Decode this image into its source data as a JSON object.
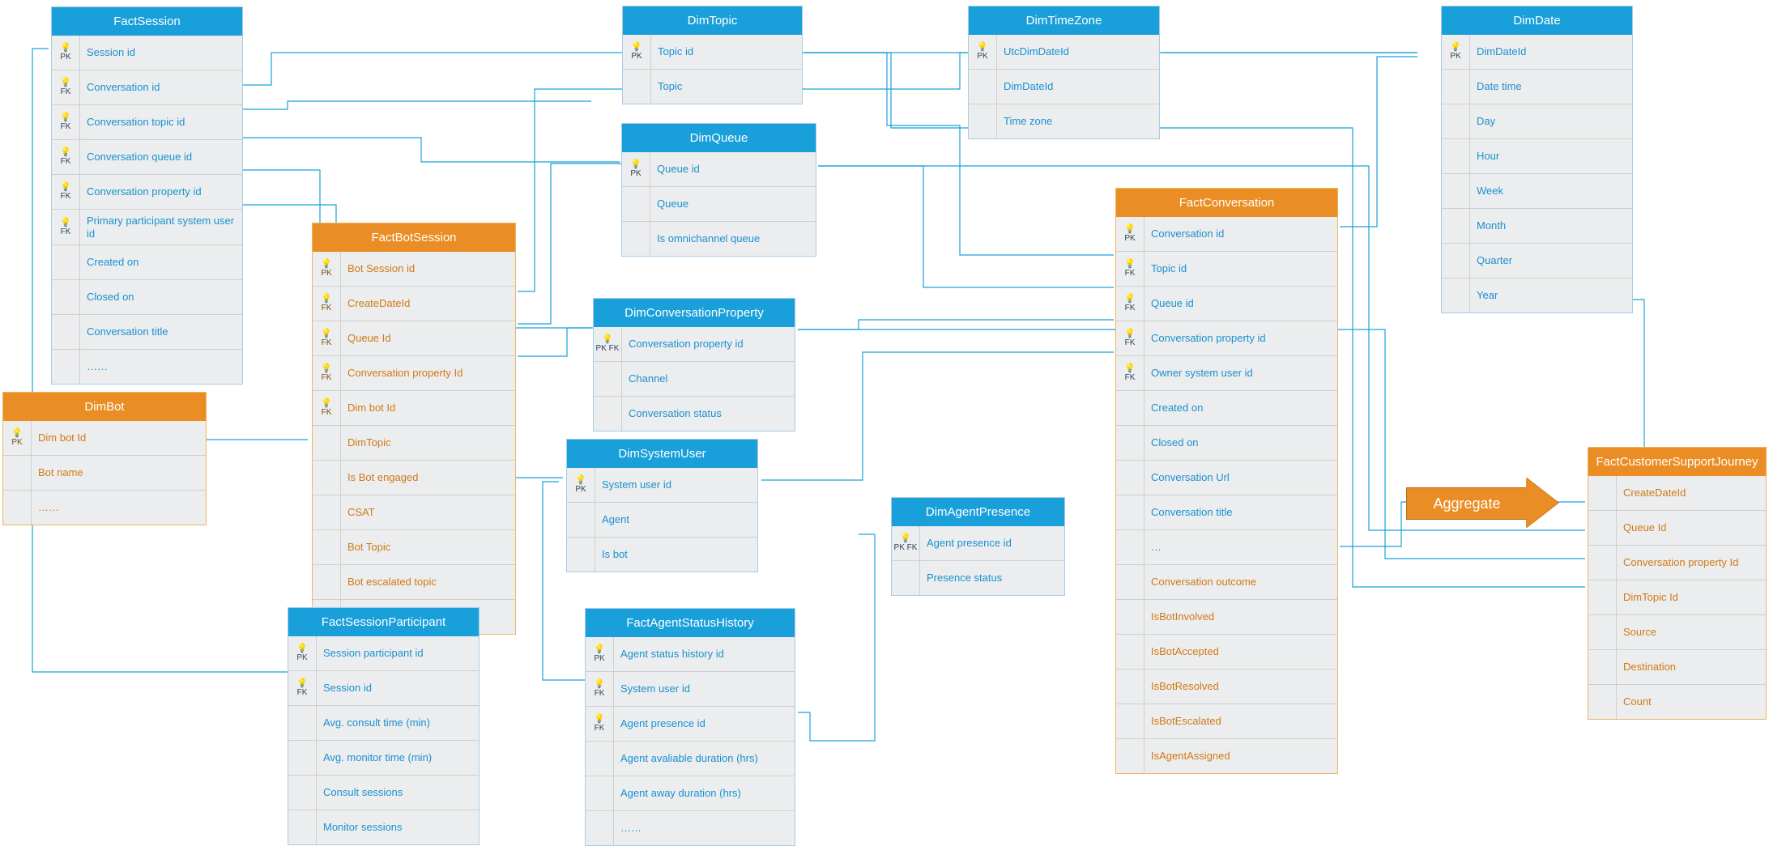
{
  "entities": {
    "factSession": {
      "title": "FactSession",
      "rows": [
        {
          "key": "PK",
          "label": "Session id"
        },
        {
          "key": "FK",
          "label": "Conversation id"
        },
        {
          "key": "FK",
          "label": "Conversation topic id"
        },
        {
          "key": "FK",
          "label": "Conversation queue id"
        },
        {
          "key": "FK",
          "label": "Conversation property id"
        },
        {
          "key": "FK",
          "label": "Primary participant system user id"
        },
        {
          "key": "",
          "label": "Created on"
        },
        {
          "key": "",
          "label": "Closed on"
        },
        {
          "key": "",
          "label": "Conversation title"
        },
        {
          "key": "",
          "label": "……"
        }
      ]
    },
    "dimBot": {
      "title": "DimBot",
      "rows": [
        {
          "key": "PK",
          "label": "Dim bot Id"
        },
        {
          "key": "",
          "label": "Bot name"
        },
        {
          "key": "",
          "label": "……"
        }
      ]
    },
    "factBotSession": {
      "title": "FactBotSession",
      "rows": [
        {
          "key": "PK",
          "label": "Bot Session id"
        },
        {
          "key": "FK",
          "label": "CreateDateId"
        },
        {
          "key": "FK",
          "label": "Queue Id"
        },
        {
          "key": "FK",
          "label": "Conversation property Id"
        },
        {
          "key": "FK",
          "label": "Dim bot Id"
        },
        {
          "key": "",
          "label": "DimTopic"
        },
        {
          "key": "",
          "label": "Is Bot engaged"
        },
        {
          "key": "",
          "label": "CSAT"
        },
        {
          "key": "",
          "label": "Bot Topic"
        },
        {
          "key": "",
          "label": "Bot escalated topic"
        },
        {
          "key": "",
          "label": "……"
        }
      ]
    },
    "factSessionParticipant": {
      "title": "FactSessionParticipant",
      "rows": [
        {
          "key": "PK",
          "label": "Session participant id"
        },
        {
          "key": "FK",
          "label": "Session id"
        },
        {
          "key": "",
          "label": "Avg. consult time (min)"
        },
        {
          "key": "",
          "label": "Avg. monitor time (min)"
        },
        {
          "key": "",
          "label": "Consult sessions"
        },
        {
          "key": "",
          "label": "Monitor sessions"
        }
      ]
    },
    "dimTopic": {
      "title": "DimTopic",
      "rows": [
        {
          "key": "PK",
          "label": "Topic id"
        },
        {
          "key": "",
          "label": "Topic"
        }
      ]
    },
    "dimQueue": {
      "title": "DimQueue",
      "rows": [
        {
          "key": "PK",
          "label": "Queue id"
        },
        {
          "key": "",
          "label": "Queue"
        },
        {
          "key": "",
          "label": "Is omnichannel queue"
        }
      ]
    },
    "dimConversationProperty": {
      "title": "DimConversationProperty",
      "rows": [
        {
          "key": "PK FK",
          "label": "Conversation property id"
        },
        {
          "key": "",
          "label": "Channel"
        },
        {
          "key": "",
          "label": "Conversation status"
        }
      ]
    },
    "dimSystemUser": {
      "title": "DimSystemUser",
      "rows": [
        {
          "key": "PK",
          "label": "System user id"
        },
        {
          "key": "",
          "label": "Agent"
        },
        {
          "key": "",
          "label": "Is bot"
        }
      ]
    },
    "factAgentStatusHistory": {
      "title": "FactAgentStatusHistory",
      "rows": [
        {
          "key": "PK",
          "label": "Agent status history id"
        },
        {
          "key": "FK",
          "label": "System user id"
        },
        {
          "key": "FK",
          "label": "Agent presence id"
        },
        {
          "key": "",
          "label": "Agent avaliable duration (hrs)"
        },
        {
          "key": "",
          "label": "Agent away duration (hrs)"
        },
        {
          "key": "",
          "label": "……"
        }
      ]
    },
    "dimTimeZone": {
      "title": "DimTimeZone",
      "rows": [
        {
          "key": "PK",
          "label": "UtcDimDateId"
        },
        {
          "key": "",
          "label": "DimDateId"
        },
        {
          "key": "",
          "label": "Time zone"
        }
      ]
    },
    "dimAgentPresence": {
      "title": "DimAgentPresence",
      "rows": [
        {
          "key": "PK FK",
          "label": "Agent presence id"
        },
        {
          "key": "",
          "label": "Presence status"
        }
      ]
    },
    "factConversation": {
      "title": "FactConversation",
      "rows": [
        {
          "key": "PK",
          "label": "Conversation id"
        },
        {
          "key": "FK",
          "label": "Topic id"
        },
        {
          "key": "FK",
          "label": "Queue id"
        },
        {
          "key": "FK",
          "label": "Conversation property id"
        },
        {
          "key": "FK",
          "label": "Owner system user id"
        },
        {
          "key": "",
          "label": "Created on"
        },
        {
          "key": "",
          "label": "Closed on"
        },
        {
          "key": "",
          "label": "Conversation Url"
        },
        {
          "key": "",
          "label": "Conversation title"
        },
        {
          "key": "",
          "label": "…"
        },
        {
          "key": "",
          "label": "Conversation outcome"
        },
        {
          "key": "",
          "label": "IsBotInvolved"
        },
        {
          "key": "",
          "label": "IsBotAccepted"
        },
        {
          "key": "",
          "label": "IsBotResolved"
        },
        {
          "key": "",
          "label": "IsBotEscalated"
        },
        {
          "key": "",
          "label": "IsAgentAssigned"
        }
      ]
    },
    "dimDate": {
      "title": "DimDate",
      "rows": [
        {
          "key": "PK",
          "label": "DimDateId"
        },
        {
          "key": "",
          "label": "Date time"
        },
        {
          "key": "",
          "label": "Day"
        },
        {
          "key": "",
          "label": "Hour"
        },
        {
          "key": "",
          "label": "Week"
        },
        {
          "key": "",
          "label": "Month"
        },
        {
          "key": "",
          "label": "Quarter"
        },
        {
          "key": "",
          "label": "Year"
        }
      ]
    },
    "factCustomerSupportJourney": {
      "title": "FactCustomerSupportJourney",
      "rows": [
        {
          "key": "",
          "label": "CreateDateId"
        },
        {
          "key": "",
          "label": "Queue Id"
        },
        {
          "key": "",
          "label": "Conversation property Id"
        },
        {
          "key": "",
          "label": "DimTopic Id"
        },
        {
          "key": "",
          "label": "Source"
        },
        {
          "key": "",
          "label": "Destination"
        },
        {
          "key": "",
          "label": "Count"
        }
      ]
    }
  },
  "arrowLabel": "Aggregate"
}
